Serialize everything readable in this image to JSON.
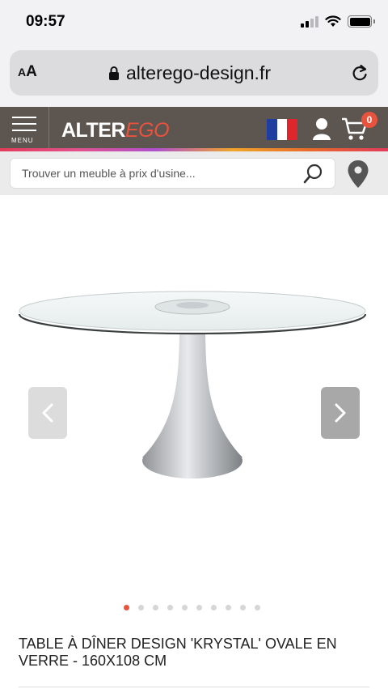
{
  "status_bar": {
    "time": "09:57",
    "signal_bars": 4,
    "signal_bars_active": 2
  },
  "browser": {
    "text_size_label_small": "A",
    "text_size_label_large": "A",
    "url": "alterego-design.fr"
  },
  "header": {
    "menu_label": "MENU",
    "logo_main": "ALTER",
    "logo_accent": "EGO",
    "cart_count": "0",
    "colors": {
      "header_bg": "#5c5550",
      "accent": "#e8533d"
    }
  },
  "search": {
    "placeholder": "Trouver un meuble à prix d'usine..."
  },
  "gallery": {
    "slide_count": 10,
    "active_slide": 1
  },
  "product": {
    "title": "TABLE À DÎNER DESIGN 'KRYSTAL' OVALE EN VERRE - 160X108 CM"
  }
}
